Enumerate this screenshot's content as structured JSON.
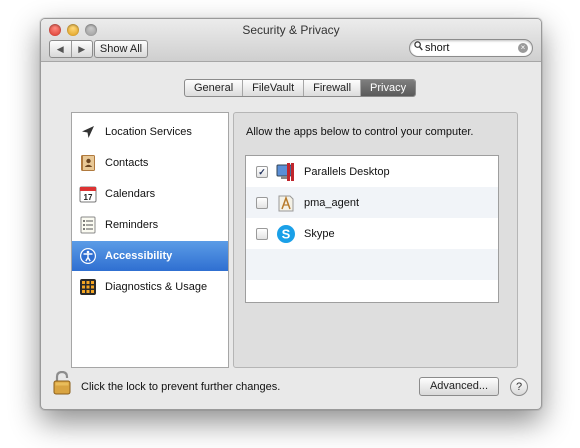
{
  "window": {
    "title": "Security & Privacy"
  },
  "toolbar": {
    "back_icon": "◀",
    "forward_icon": "▶",
    "show_all_label": "Show All",
    "search": {
      "value": "short",
      "placeholder": ""
    }
  },
  "tabs": [
    {
      "label": "General",
      "active": false
    },
    {
      "label": "FileVault",
      "active": false
    },
    {
      "label": "Firewall",
      "active": false
    },
    {
      "label": "Privacy",
      "active": true
    }
  ],
  "sidebar": {
    "items": [
      {
        "label": "Location Services",
        "icon": "location-arrow-icon",
        "selected": false
      },
      {
        "label": "Contacts",
        "icon": "contacts-book-icon",
        "selected": false
      },
      {
        "label": "Calendars",
        "icon": "calendar-icon",
        "calendar_day": "17",
        "selected": false
      },
      {
        "label": "Reminders",
        "icon": "reminders-list-icon",
        "selected": false
      },
      {
        "label": "Accessibility",
        "icon": "accessibility-icon",
        "selected": true
      },
      {
        "label": "Diagnostics & Usage",
        "icon": "diagnostics-grid-icon",
        "selected": false
      }
    ]
  },
  "main": {
    "instruction": "Allow the apps below to control your computer.",
    "apps": [
      {
        "name": "Parallels Desktop",
        "checked": true,
        "icon": "parallels-desktop-icon"
      },
      {
        "name": "pma_agent",
        "checked": false,
        "icon": "pma-agent-icon"
      },
      {
        "name": "Skype",
        "checked": false,
        "icon": "skype-icon"
      }
    ]
  },
  "footer": {
    "lock_message": "Click the lock to prevent further changes.",
    "advanced_label": "Advanced...",
    "help_label": "?"
  },
  "colors": {
    "selection": "#2f6fd1",
    "active_tab": "#5a5a5a",
    "skype_blue": "#1aa0e8"
  }
}
